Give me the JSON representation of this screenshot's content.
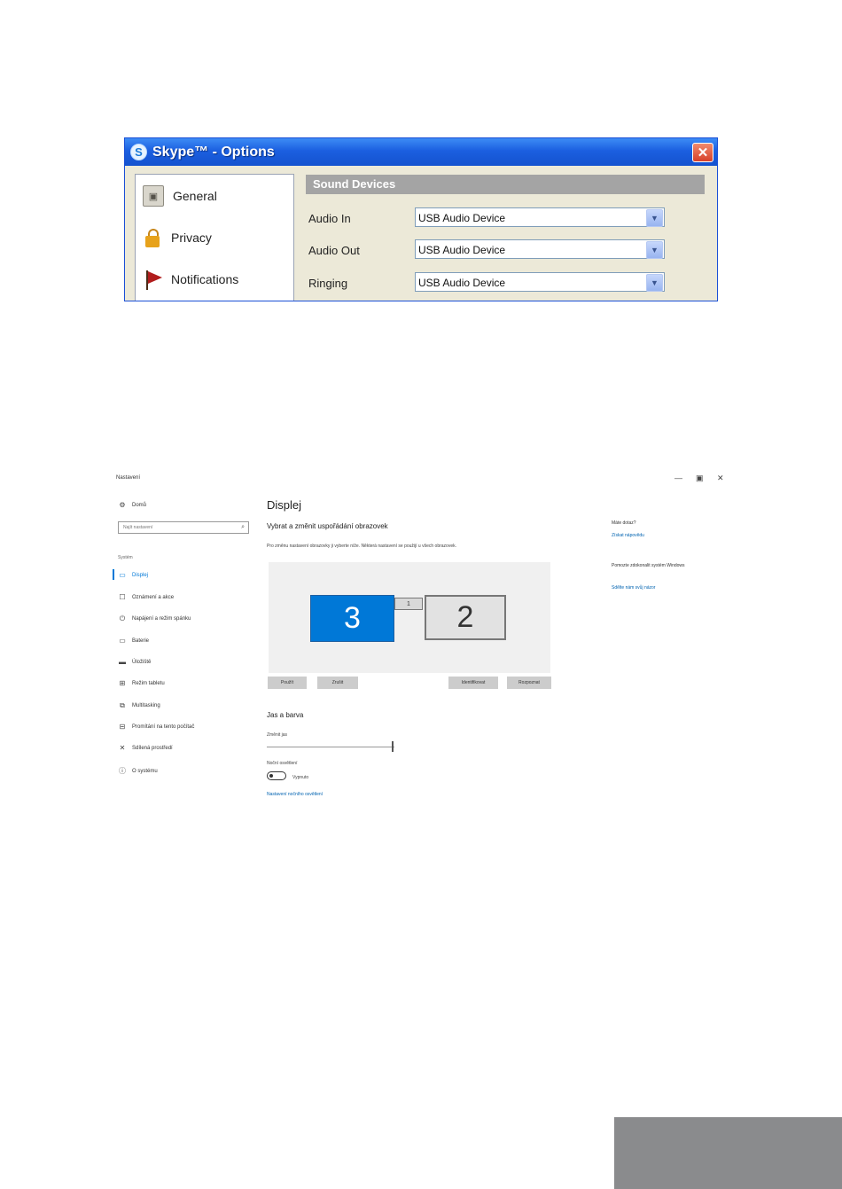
{
  "skype": {
    "title": "Skype™ - Options",
    "close": "✕",
    "nav": [
      {
        "label": "General"
      },
      {
        "label": "Privacy"
      },
      {
        "label": "Notifications"
      }
    ],
    "section_title": "Sound Devices",
    "rows": [
      {
        "label": "Audio In",
        "value": "USB Audio Device"
      },
      {
        "label": "Audio Out",
        "value": "USB Audio Device"
      },
      {
        "label": "Ringing",
        "value": "USB Audio Device"
      }
    ]
  },
  "settings": {
    "window_title": "Nastavení",
    "controls": [
      "—",
      "▣",
      "✕"
    ],
    "home": "Domů",
    "search_placeholder": "Najít nastavení",
    "group": "Systém",
    "nav": [
      {
        "label": "Displej",
        "icon": "monitor-icon"
      },
      {
        "label": "Oznámení a akce",
        "icon": "notification-icon"
      },
      {
        "label": "Napájení a režim spánku",
        "icon": "power-icon"
      },
      {
        "label": "Baterie",
        "icon": "battery-icon"
      },
      {
        "label": "Úložiště",
        "icon": "storage-icon"
      },
      {
        "label": "Režim tabletu",
        "icon": "tablet-icon"
      },
      {
        "label": "Multitasking",
        "icon": "multitasking-icon"
      },
      {
        "label": "Promítání na tento počítač",
        "icon": "projecting-icon"
      },
      {
        "label": "Sdílená prostředí",
        "icon": "shared-icon"
      },
      {
        "label": "O systému",
        "icon": "info-icon"
      }
    ],
    "page_title": "Displej",
    "section_title": "Vybrat a změnit uspořádání obrazovek",
    "description": "Pro změnu nastavení obrazovky ji vyberte níže. Některá nastavení se použijí u všech obrazovek.",
    "monitors": {
      "a": "3",
      "b": "2",
      "c": "1"
    },
    "buttons": {
      "apply": "Použít",
      "cancel": "Zrušit",
      "identify": "Identifikovat",
      "detect": "Rozpoznat"
    },
    "brightness_title": "Jas a barva",
    "brightness_label": "Změnit jas",
    "night_light_label": "Noční osvětlení",
    "night_light_state": "Vypnuto",
    "night_light_link": "Nastavení nočního osvětlení",
    "side": {
      "question": "Máte dotaz?",
      "help_link": "Získat nápovědu",
      "improve_text": "Pomozte zdokonalit systém Windows",
      "feedback_link": "Sdělte nám svůj názor"
    }
  }
}
